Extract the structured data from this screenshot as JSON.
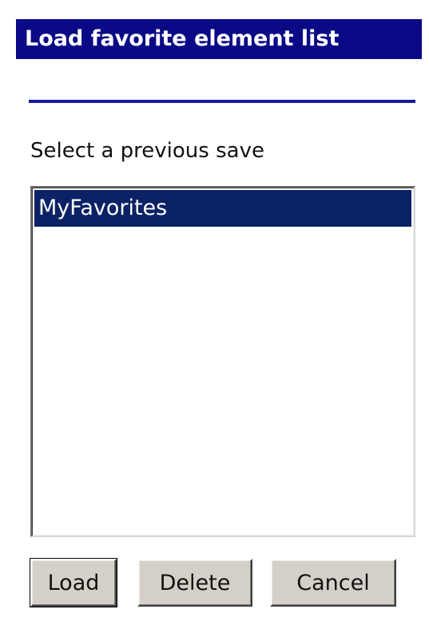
{
  "dialog": {
    "title": "Load favorite element list",
    "prompt": "Select a previous save",
    "title_bar_color": "#0a0a86",
    "selection_color": "#0c2266"
  },
  "list": {
    "items": [
      {
        "label": "MyFavorites",
        "selected": true
      }
    ]
  },
  "buttons": {
    "load": "Load",
    "delete": "Delete",
    "cancel": "Cancel"
  }
}
